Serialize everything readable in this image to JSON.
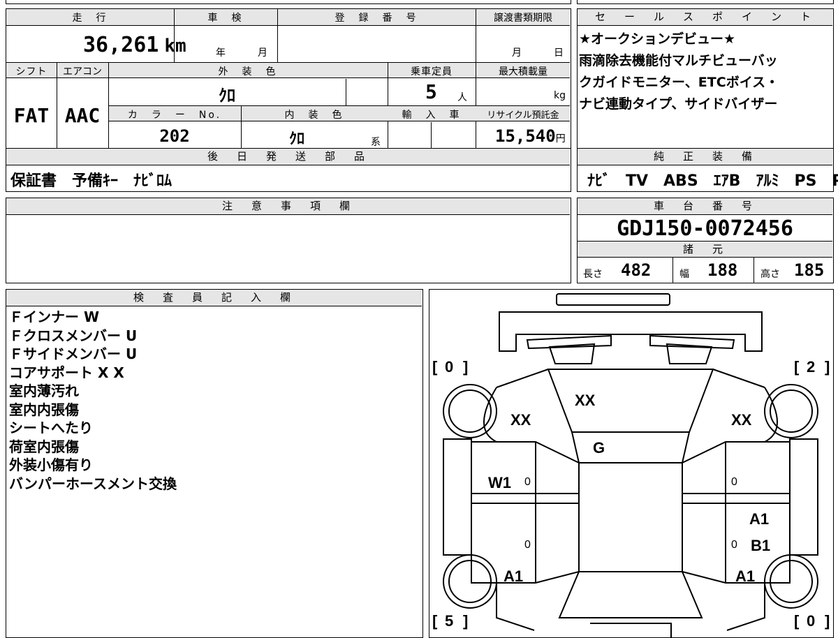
{
  "mileage": {
    "label": "走　行",
    "value": "36,261",
    "unit": "km"
  },
  "shaken": {
    "label": "車　検",
    "year_unit": "年",
    "month_unit": "月"
  },
  "registration": {
    "label": "登　録　番　号",
    "value": ""
  },
  "transfer_deadline": {
    "label": "譲渡書類期限",
    "month_unit": "月",
    "day_unit": "日"
  },
  "shift": {
    "label": "シフト",
    "value": "FAT"
  },
  "aircon": {
    "label": "エアコン",
    "value": "AAC"
  },
  "exterior_color": {
    "label": "外　装　色",
    "value": "ｸﾛ"
  },
  "capacity": {
    "label": "乗車定員",
    "value": "5",
    "unit": "人"
  },
  "max_load": {
    "label": "最大積載量",
    "unit": "kg"
  },
  "color_no": {
    "label": "カ　ラ　ー　No.",
    "value": "202"
  },
  "interior_color": {
    "label": "内　装　色",
    "value": "ｸﾛ",
    "suffix": "系"
  },
  "import": {
    "label": "輸　入　車"
  },
  "recycle": {
    "label": "リサイクル預託金",
    "value": "15,540",
    "unit": "円"
  },
  "later_parts": {
    "label": "後　日　発　送　部　品",
    "value": "保証書　予備ｷｰ　ﾅﾋﾞﾛﾑ"
  },
  "sales_point": {
    "label": "セ　ー　ル　ス　ポ　イ　ン　ト",
    "lines": [
      "★オークションデビュー★",
      "雨滴除去機能付マルチビューバッ",
      "クガイドモニター、ETCボイス・",
      "ナビ連動タイプ、サイドバイザー"
    ]
  },
  "genuine_equipment": {
    "label": "純　正　装　備",
    "value": "ﾅﾋﾞ　TV　ABS　ｴｱB　ｱﾙﾐ　PS　PW"
  },
  "caution": {
    "label": "注　意　事　項　欄"
  },
  "chassis_no": {
    "label": "車　台　番　号",
    "value": "GDJ150-0072456"
  },
  "specs": {
    "label": "諸　元",
    "length_label": "長さ",
    "length": "482",
    "width_label": "幅",
    "width": "188",
    "height_label": "高さ",
    "height": "185"
  },
  "inspector": {
    "label": "検　査　員　記　入　欄",
    "notes": [
      "Ｆインナー W",
      "Ｆクロスメンバー U",
      "Ｆサイドメンバー U",
      "コアサポート X X",
      "室内薄汚れ",
      "室内内張傷",
      "シートへたり",
      "荷室内張傷",
      "外装小傷有り",
      "バンパーホースメント交換"
    ]
  },
  "diagram": {
    "tire_fl": "0",
    "tire_fr": "2",
    "tire_rl": "5",
    "tire_rr": "0",
    "hood": "XX",
    "fender_left": "XX",
    "fender_right": "XX",
    "windshield": "G",
    "door_fl": "W1",
    "door_fl_small": "0",
    "door_rl_small": "0",
    "door_fr_small": "0",
    "door_rr_small": "0",
    "door_rr_a": "A1",
    "door_rr_b": "B1",
    "quarter_left": "A1",
    "quarter_right": "A1"
  }
}
